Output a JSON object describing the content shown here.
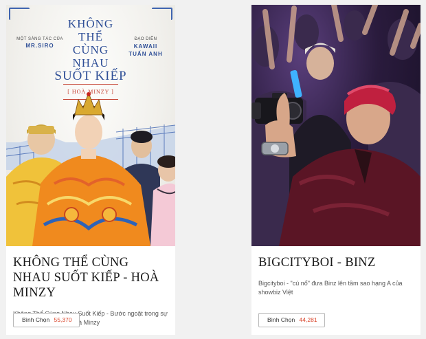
{
  "cards": [
    {
      "poster": {
        "title_lines": [
          "KHÔNG",
          "THỂ",
          "CÙNG",
          "NHAU",
          "SUỐT KIẾP"
        ],
        "tag": "[ HOÀ MINZY ]",
        "credit_left_label": "MỘT SÁNG TÁC CỦA",
        "credit_left_name": "MR.SIRO",
        "credit_right_label": "ĐẠO DIỄN",
        "credit_right_name_1": "KAWAII",
        "credit_right_name_2": "TUẤN ANH",
        "colors": {
          "title": "#2f4f97",
          "robe": "#f08a1e",
          "accent_blue": "#3f64b0"
        }
      },
      "title": "KHÔNG THỂ CÙNG NHAU SUỐT KIẾP - HOÀ MINZY",
      "description": "Không Thể Cùng Nhau Suốt Kiếp - Bước ngoặt trong sự nghiệp âm nhạc của Hoà Minzy",
      "vote_label": "Bình Chọn",
      "vote_count": "55,370"
    },
    {
      "poster": {
        "colors": {
          "background": "#2a1b3d",
          "hair": "#c0203f",
          "jacket": "#5a1525"
        }
      },
      "title": "BIGCITYBOI - BINZ",
      "description": "Bigcityboi - \"cú nổ\" đưa Binz lên tầm sao hạng A của showbiz Việt",
      "vote_label": "Bình Chọn",
      "vote_count": "44,281"
    }
  ],
  "accent_color": "#d9452b"
}
